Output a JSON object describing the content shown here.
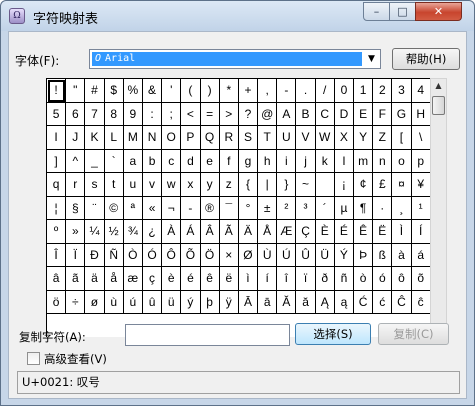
{
  "window": {
    "title": "字符映射表",
    "minimize_glyph": "–",
    "maximize_glyph": "□",
    "close_glyph": "✕"
  },
  "font": {
    "label": "字体(F):",
    "selected": "Arial",
    "type_icon": "O",
    "arrow_glyph": "▼"
  },
  "help_button": "帮助(H)",
  "characters": [
    "!",
    "\"",
    "#",
    "$",
    "%",
    "&",
    "'",
    "(",
    ")",
    "*",
    "+",
    ",",
    "-",
    ".",
    "/",
    "0",
    "1",
    "2",
    "3",
    "4",
    "5",
    "6",
    "7",
    "8",
    "9",
    ":",
    ";",
    "<",
    "=",
    ">",
    "?",
    "@",
    "A",
    "B",
    "C",
    "D",
    "E",
    "F",
    "G",
    "H",
    "I",
    "J",
    "K",
    "L",
    "M",
    "N",
    "O",
    "P",
    "Q",
    "R",
    "S",
    "T",
    "U",
    "V",
    "W",
    "X",
    "Y",
    "Z",
    "[",
    "\\",
    "]",
    "^",
    "_",
    "`",
    "a",
    "b",
    "c",
    "d",
    "e",
    "f",
    "g",
    "h",
    "i",
    "j",
    "k",
    "l",
    "m",
    "n",
    "o",
    "p",
    "q",
    "r",
    "s",
    "t",
    "u",
    "v",
    "w",
    "x",
    "y",
    "z",
    "{",
    "|",
    "}",
    "~",
    "",
    "¡",
    "¢",
    "£",
    "¤",
    "¥",
    "¦",
    "§",
    "¨",
    "©",
    "ª",
    "«",
    "¬",
    "-",
    "®",
    "¯",
    "°",
    "±",
    "²",
    "³",
    "´",
    "µ",
    "¶",
    "·",
    "¸",
    "¹",
    "º",
    "»",
    "¼",
    "½",
    "¾",
    "¿",
    "À",
    "Á",
    "Â",
    "Ã",
    "Ä",
    "Å",
    "Æ",
    "Ç",
    "È",
    "É",
    "Ê",
    "Ë",
    "Ì",
    "Í",
    "Î",
    "Ï",
    "Ð",
    "Ñ",
    "Ò",
    "Ó",
    "Ô",
    "Õ",
    "Ö",
    "×",
    "Ø",
    "Ù",
    "Ú",
    "Û",
    "Ü",
    "Ý",
    "Þ",
    "ß",
    "à",
    "á",
    "â",
    "ã",
    "ä",
    "å",
    "æ",
    "ç",
    "è",
    "é",
    "ê",
    "ë",
    "ì",
    "í",
    "î",
    "ï",
    "ð",
    "ñ",
    "ò",
    "ó",
    "ô",
    "õ",
    "ö",
    "÷",
    "ø",
    "ù",
    "ú",
    "û",
    "ü",
    "ý",
    "þ",
    "ÿ",
    "Ā",
    "ā",
    "Ă",
    "ă",
    "Ą",
    "ą",
    "Ć",
    "ć",
    "Ĉ",
    "ĉ"
  ],
  "scrollbar": {
    "up_glyph": "▲",
    "down_glyph": "▼"
  },
  "copy": {
    "label": "复制字符(A):",
    "value": "",
    "select_button": "选择(S)",
    "copy_button": "复制(C)"
  },
  "advanced_view": {
    "label": "高级查看(V)",
    "checked": false
  },
  "status": "U+0021: 叹号"
}
